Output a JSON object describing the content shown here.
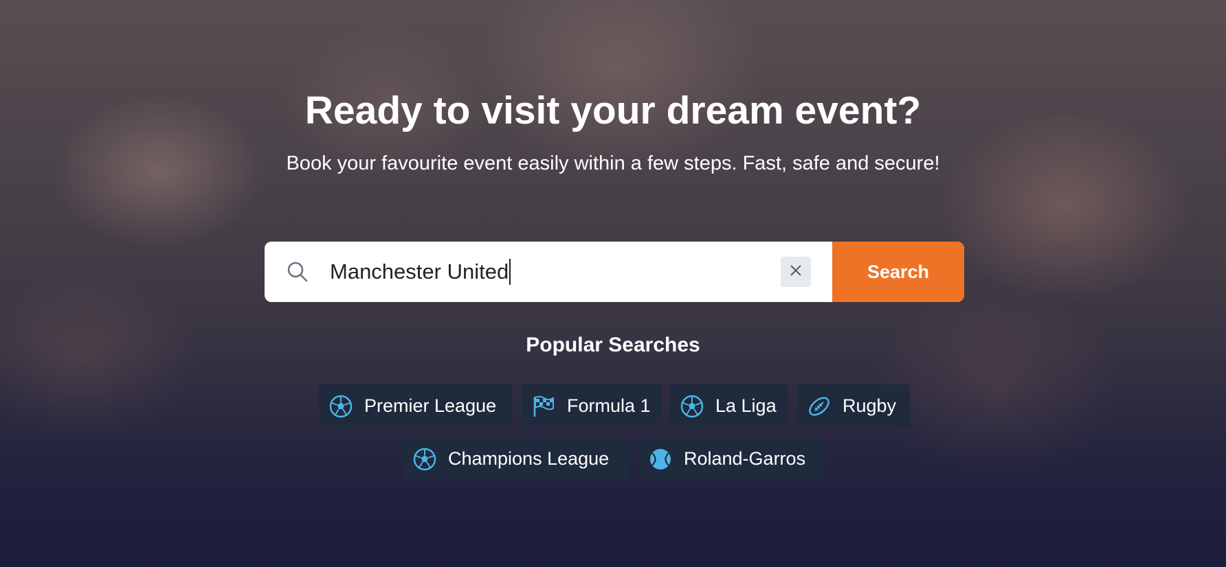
{
  "hero": {
    "headline": "Ready to visit your dream event?",
    "subheadline": "Book your favourite event easily within a few steps. Fast, safe and secure!"
  },
  "search": {
    "value": "Manchester United",
    "icon": "search-icon",
    "clear_icon": "close-icon",
    "button_label": "Search"
  },
  "popular": {
    "title": "Popular Searches",
    "items": [
      {
        "label": "Premier League",
        "icon": "soccer-ball-icon"
      },
      {
        "label": "Formula 1",
        "icon": "checkered-flag-icon"
      },
      {
        "label": "La Liga",
        "icon": "soccer-ball-icon"
      },
      {
        "label": "Rugby",
        "icon": "rugby-ball-icon"
      },
      {
        "label": "Champions League",
        "icon": "soccer-ball-icon"
      },
      {
        "label": "Roland-Garros",
        "icon": "tennis-ball-icon"
      }
    ]
  },
  "colors": {
    "accent": "#ef7326",
    "chip_background": "#1f2a3d",
    "chip_icon": "#4fb3e8"
  }
}
